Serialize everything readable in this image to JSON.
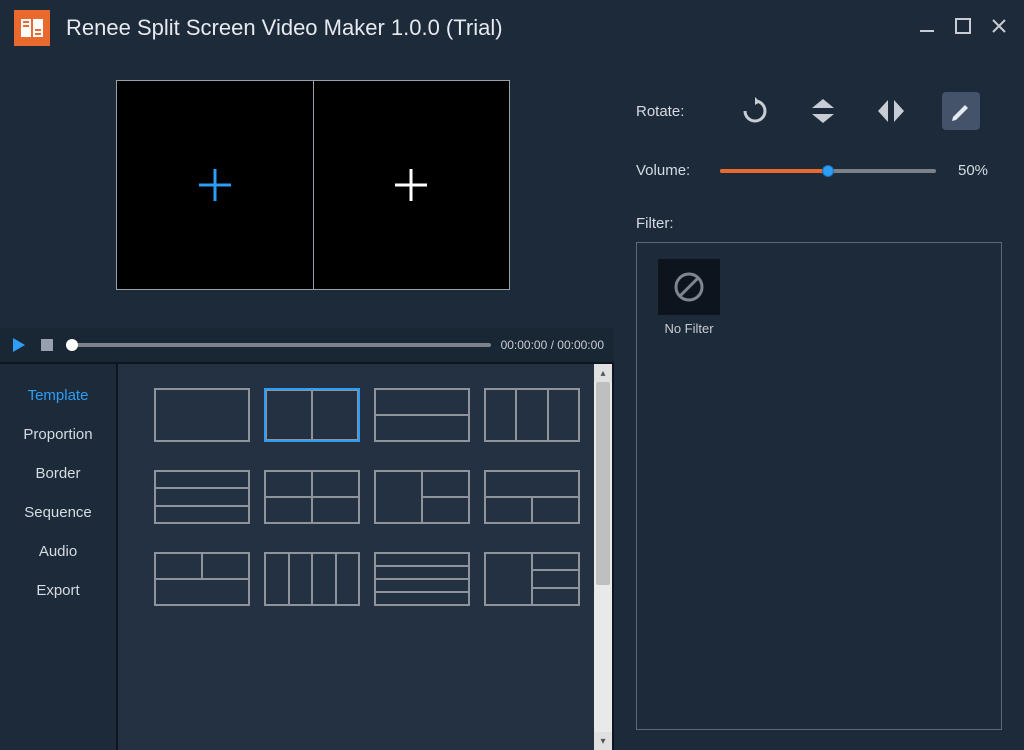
{
  "app": {
    "title": "Renee Split Screen Video Maker 1.0.0 (Trial)"
  },
  "playback": {
    "time_readout": "00:00:00 / 00:00:00",
    "position_pct": 0
  },
  "sidebar": {
    "tabs": [
      {
        "label": "Template",
        "active": true
      },
      {
        "label": "Proportion",
        "active": false
      },
      {
        "label": "Border",
        "active": false
      },
      {
        "label": "Sequence",
        "active": false
      },
      {
        "label": "Audio",
        "active": false
      },
      {
        "label": "Export",
        "active": false
      }
    ]
  },
  "templates": {
    "selected_index": 1,
    "items": [
      {
        "cols": 1,
        "rows": 1
      },
      {
        "cols": 2,
        "rows": 1
      },
      {
        "cols": 1,
        "rows": 2
      },
      {
        "cols": 3,
        "rows": 1
      },
      {
        "cols": 1,
        "rows": 3
      },
      {
        "cols": 2,
        "rows": 2
      },
      {
        "layout": "col-1-2"
      },
      {
        "layout": "row-1-2"
      },
      {
        "layout": "row-2-1"
      },
      {
        "cols": 4,
        "rows": 1
      },
      {
        "cols": 1,
        "rows": 4
      },
      {
        "layout": "two-over-two-stripes"
      }
    ]
  },
  "rotate": {
    "label": "Rotate:"
  },
  "volume": {
    "label": "Volume:",
    "percent": 50,
    "display": "50%"
  },
  "filter": {
    "label": "Filter:",
    "items": [
      {
        "name": "No Filter"
      }
    ]
  }
}
